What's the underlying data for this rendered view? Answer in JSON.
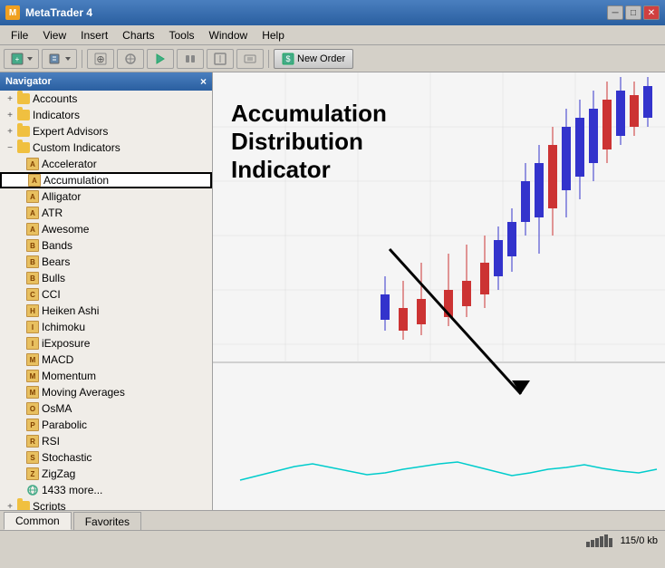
{
  "titleBar": {
    "title": "MetaTrader 4",
    "minBtn": "─",
    "maxBtn": "□",
    "closeBtn": "✕"
  },
  "menuBar": {
    "items": [
      "File",
      "View",
      "Insert",
      "Charts",
      "Tools",
      "Window",
      "Help"
    ]
  },
  "toolbar": {
    "newOrderLabel": "New Order"
  },
  "navigator": {
    "title": "Navigator",
    "closeLabel": "×",
    "sections": [
      {
        "id": "accounts",
        "label": "Accounts",
        "expanded": true,
        "indent": 0
      },
      {
        "id": "indicators",
        "label": "Indicators",
        "expanded": false,
        "indent": 0
      },
      {
        "id": "expertAdvisors",
        "label": "Expert Advisors",
        "expanded": false,
        "indent": 0
      },
      {
        "id": "customIndicators",
        "label": "Custom Indicators",
        "expanded": true,
        "indent": 0
      }
    ],
    "customIndicatorItems": [
      "Accelerator",
      "Accumulation",
      "Alligator",
      "ATR",
      "Awesome",
      "Bands",
      "Bears",
      "Bulls",
      "CCI",
      "Heiken Ashi",
      "Ichimoku",
      "iExposure",
      "MACD",
      "Momentum",
      "Moving Averages",
      "OsMA",
      "Parabolic",
      "RSI",
      "Stochastic",
      "ZigZag",
      "1433 more..."
    ],
    "scriptsLabel": "Scripts"
  },
  "chart": {
    "annotationLine1": "Accumulation",
    "annotationLine2": "Distribution",
    "annotationLine3": "Indicator"
  },
  "tabs": {
    "items": [
      "Common",
      "Favorites"
    ]
  },
  "statusBar": {
    "memoryInfo": "115/0 kb"
  }
}
